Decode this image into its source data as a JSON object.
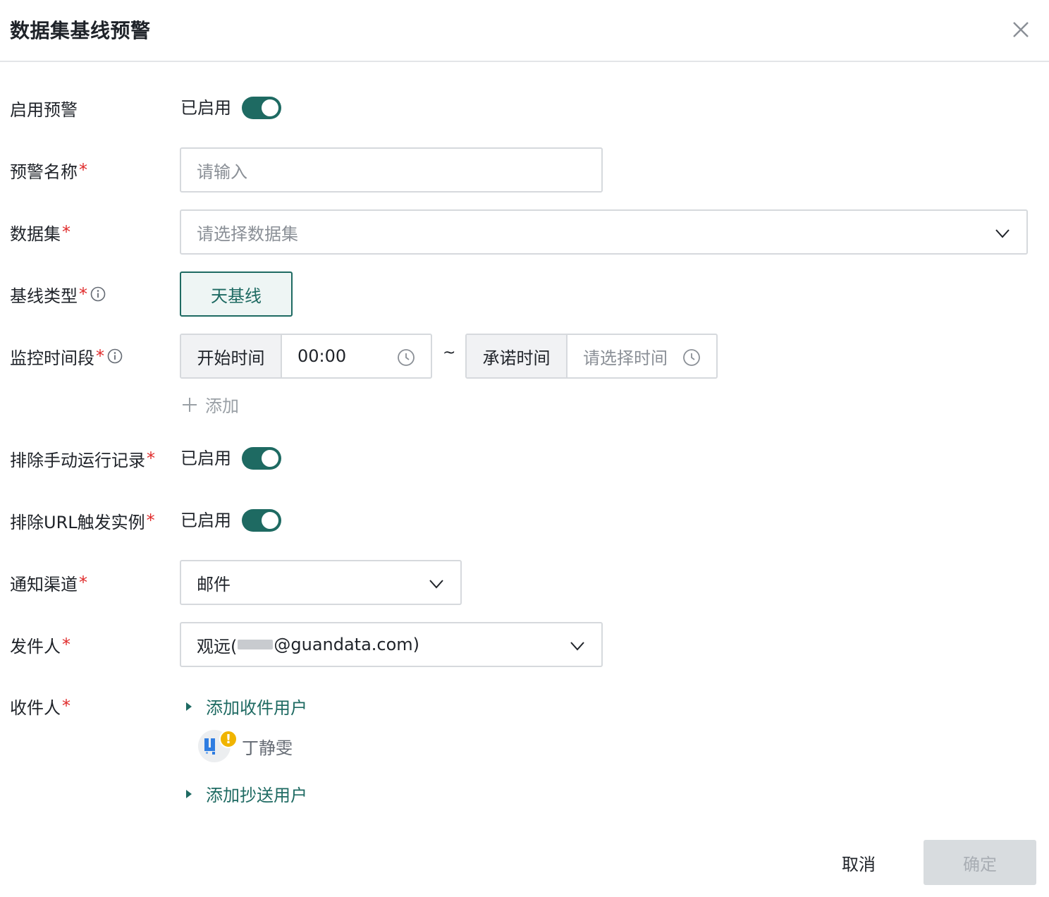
{
  "dialog": {
    "title": "数据集基线预警"
  },
  "form": {
    "enable_alert": {
      "label": "启用预警",
      "status": "已启用",
      "on": true
    },
    "alert_name": {
      "label": "预警名称",
      "placeholder": "请输入"
    },
    "dataset": {
      "label": "数据集",
      "placeholder": "请选择数据集"
    },
    "baseline_type": {
      "label": "基线类型",
      "option": "天基线"
    },
    "monitor_period": {
      "label": "监控时间段",
      "start_label": "开始时间",
      "start_value": "00:00",
      "separator": "~",
      "commit_label": "承诺时间",
      "commit_placeholder": "请选择时间",
      "add_label": "添加"
    },
    "exclude_manual": {
      "label": "排除手动运行记录",
      "status": "已启用",
      "on": true
    },
    "exclude_url": {
      "label": "排除URL触发实例",
      "status": "已启用",
      "on": true
    },
    "channel": {
      "label": "通知渠道",
      "value": "邮件"
    },
    "sender": {
      "label": "发件人",
      "value_prefix": "观远(",
      "value_suffix": "@guandata.com)"
    },
    "recipients": {
      "label": "收件人",
      "add_recipient_label": "添加收件用户",
      "users": [
        {
          "name": "丁静雯",
          "warning": "!"
        }
      ],
      "add_cc_label": "添加抄送用户"
    },
    "required_mark": "*"
  },
  "footer": {
    "cancel_label": "取消",
    "confirm_label": "确定"
  },
  "colors": {
    "accent": "#1e6a62",
    "required": "#e02b2b",
    "warning": "#f0b400"
  }
}
